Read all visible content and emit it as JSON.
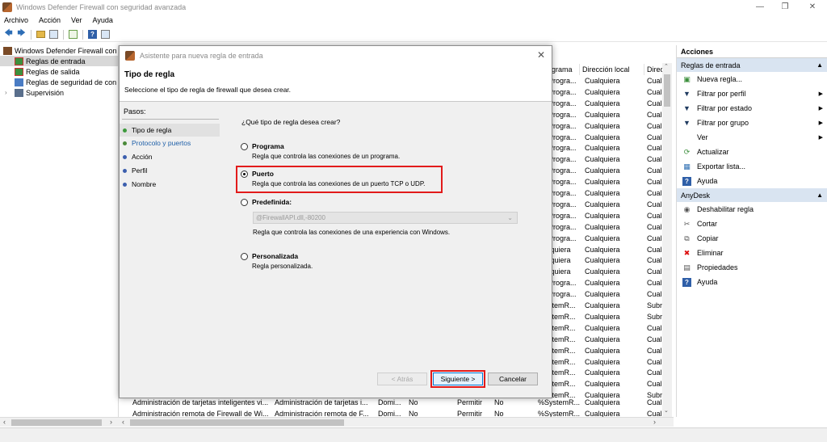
{
  "window": {
    "title": "Windows Defender Firewall con seguridad avanzada",
    "min_icon": "minimize-icon",
    "max_icon": "restore-icon",
    "close_icon": "close-icon"
  },
  "menu": [
    "Archivo",
    "Acción",
    "Ver",
    "Ayuda"
  ],
  "tree": {
    "root": "Windows Defender Firewall con",
    "items": [
      "Reglas de entrada",
      "Reglas de salida",
      "Reglas de seguridad de con",
      "Supervisión"
    ]
  },
  "table": {
    "headers": [
      "grama",
      "Dirección local",
      "Direc"
    ],
    "col_progr": [
      "Progra...",
      "Progra...",
      "Progra...",
      "Progra...",
      "Progra...",
      "Progra...",
      "Progra...",
      "Progra...",
      "Progra...",
      "Progra...",
      "Progra...",
      "Progra...",
      "Progra...",
      "Progra...",
      "Progra...",
      "Iquiera",
      "Iquiera",
      "Iquiera",
      "Progra...",
      "Progra...",
      "stemR...",
      "stemR...",
      "stemR...",
      "stemR...",
      "stemR...",
      "stemR...",
      "stemR...",
      "stemR...",
      "stemR..."
    ],
    "col_local": [
      "Cualquiera",
      "Cualquiera",
      "Cualquiera",
      "Cualquiera",
      "Cualquiera",
      "Cualquiera",
      "Cualquiera",
      "Cualquiera",
      "Cualquiera",
      "Cualquiera",
      "Cualquiera",
      "Cualquiera",
      "Cualquiera",
      "Cualquiera",
      "Cualquiera",
      "Cualquiera",
      "Cualquiera",
      "Cualquiera",
      "Cualquiera",
      "Cualquiera",
      "Cualquiera",
      "Cualquiera",
      "Cualquiera",
      "Cualquiera",
      "Cualquiera",
      "Cualquiera",
      "Cualquiera",
      "Cualquiera",
      "Cualquiera",
      "Cualquiera"
    ],
    "col_dir": [
      "Cual",
      "Cual",
      "Cual",
      "Cual",
      "Cual",
      "Cual",
      "Cual",
      "Cual",
      "Cual",
      "Cual",
      "Cual",
      "Cual",
      "Cual",
      "Cual",
      "Cual",
      "Cual",
      "Cual",
      "Cual",
      "Cual",
      "Cual",
      "Subr",
      "Subr",
      "Cual",
      "Cual",
      "Cual",
      "Cual",
      "Cual",
      "Cual",
      "Subr",
      "Subr"
    ],
    "bottom_rows": [
      {
        "name": "Administración de tarjetas inteligentes vi...",
        "group": "Administración de tarjetas i...",
        "profile": "Domi...",
        "enabled": "No",
        "action": "Permitir",
        "override": "No",
        "program": "%SystemR...",
        "local": "Cualquiera",
        "remote": "Cual"
      },
      {
        "name": "Administración remota de Firewall de Wi...",
        "group": "Administración remota de F...",
        "profile": "Domi...",
        "enabled": "No",
        "action": "Permitir",
        "override": "No",
        "program": "%SystemR...",
        "local": "Cualquiera",
        "remote": "Cual"
      }
    ]
  },
  "actions": {
    "title": "Acciones",
    "section1": "Reglas de entrada",
    "items1": [
      {
        "label": "Nueva regla...",
        "icon": "new-rule-icon"
      },
      {
        "label": "Filtrar por perfil",
        "icon": "filter-icon",
        "submenu": true
      },
      {
        "label": "Filtrar por estado",
        "icon": "filter-icon",
        "submenu": true
      },
      {
        "label": "Filtrar por grupo",
        "icon": "filter-icon",
        "submenu": true
      },
      {
        "label": "Ver",
        "icon": "",
        "submenu": true
      },
      {
        "label": "Actualizar",
        "icon": "refresh-icon"
      },
      {
        "label": "Exportar lista...",
        "icon": "export-icon"
      },
      {
        "label": "Ayuda",
        "icon": "help-icon"
      }
    ],
    "section2": "AnyDesk",
    "items2": [
      {
        "label": "Deshabilitar regla",
        "icon": "disable-rule-icon"
      },
      {
        "label": "Cortar",
        "icon": "cut-icon"
      },
      {
        "label": "Copiar",
        "icon": "copy-icon"
      },
      {
        "label": "Eliminar",
        "icon": "delete-icon"
      },
      {
        "label": "Propiedades",
        "icon": "properties-icon"
      },
      {
        "label": "Ayuda",
        "icon": "help-icon"
      }
    ]
  },
  "dialog": {
    "title": "Asistente para nueva regla de entrada",
    "heading": "Tipo de regla",
    "subheading": "Seleccione el tipo de regla de firewall que desea crear.",
    "steps_title": "Pasos:",
    "steps": [
      "Tipo de regla",
      "Protocolo y puertos",
      "Acción",
      "Perfil",
      "Nombre"
    ],
    "question": "¿Qué tipo de regla desea crear?",
    "options": [
      {
        "label": "Programa",
        "desc": "Regla que controla las conexiones de un programa."
      },
      {
        "label": "Puerto",
        "desc": "Regla que controla las conexiones de un puerto TCP o UDP."
      },
      {
        "label": "Predefinida:",
        "desc": "Regla que controla las conexiones de una experiencia con Windows."
      },
      {
        "label": "Personalizada",
        "desc": "Regla personalizada."
      }
    ],
    "selected_option": "Puerto",
    "predefined_value": "@FirewallAPI.dll,-80200",
    "buttons": {
      "back": "< Atrás",
      "next": "Siguiente >",
      "cancel": "Cancelar"
    }
  },
  "colors": {
    "highlight": "#e21b1b",
    "section_bg": "#d9e4f1",
    "panel_bg": "#f0f0f0",
    "step_current": "#3c9a3c",
    "step_done": "#4a8a3a",
    "step_pending": "#3c5fae"
  }
}
